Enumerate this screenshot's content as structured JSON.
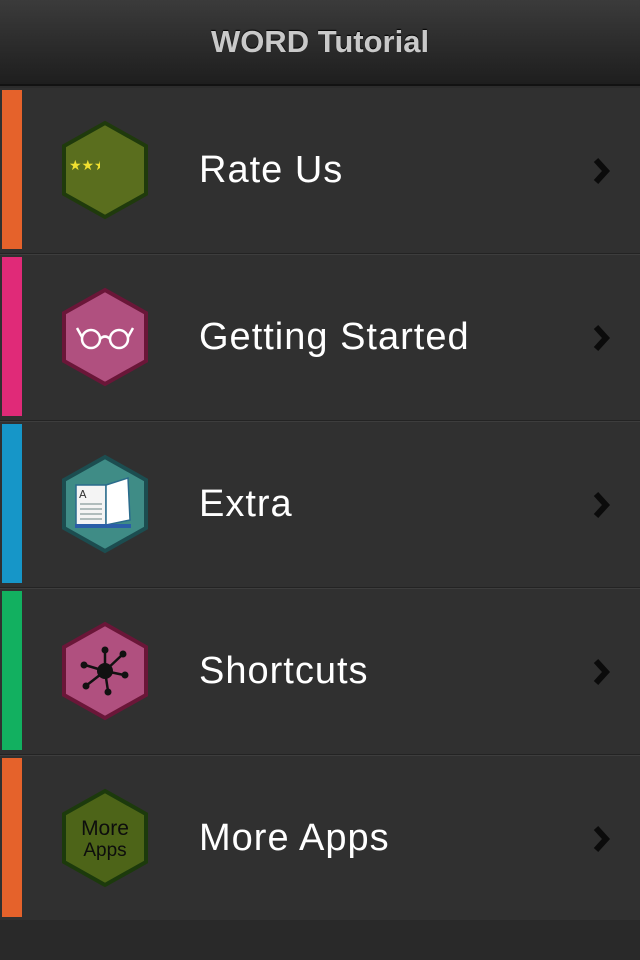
{
  "navbar": {
    "title": "WORD Tutorial"
  },
  "menu": {
    "items": [
      {
        "label": "Rate Us",
        "accent": "#e5622b",
        "icon": "stars-icon",
        "icon_fill": "#5a6e1e",
        "icon_border": "#1f3a0c"
      },
      {
        "label": "Getting Started",
        "accent": "#e02a78",
        "icon": "glasses-icon",
        "icon_fill": "#b0507f",
        "icon_border": "#6a1638"
      },
      {
        "label": "Extra",
        "accent": "#1696c8",
        "icon": "book-icon",
        "icon_fill": "#3f8c86",
        "icon_border": "#1c4d50"
      },
      {
        "label": "Shortcuts",
        "accent": "#12b060",
        "icon": "network-icon",
        "icon_fill": "#b0507f",
        "icon_border": "#6a1638"
      },
      {
        "label": "More Apps",
        "accent": "#e5622b",
        "icon": "more-apps-icon",
        "icon_fill": "#4d6418",
        "icon_border": "#1c3a0c",
        "icon_text_1": "More",
        "icon_text_2": "Apps"
      }
    ]
  }
}
